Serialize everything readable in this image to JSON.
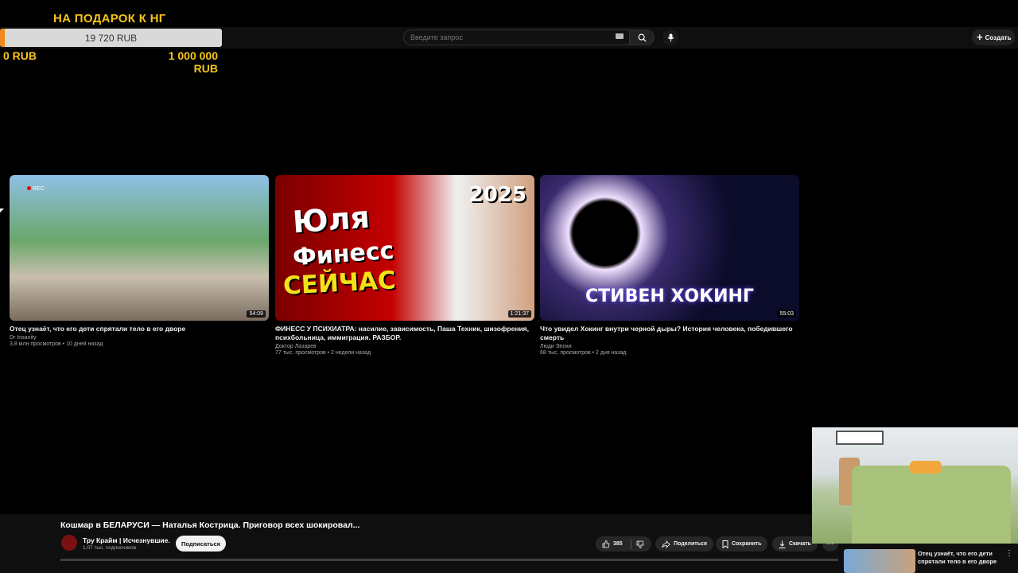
{
  "donation": {
    "title": "НА ПОДАРОК К НГ",
    "amount": "19 720 RUB",
    "min": "0 RUB",
    "max": "1 000 000 RUB",
    "progress_fraction": 0.0197,
    "fill_color": "#f08a1c",
    "text_color": "#f5c518"
  },
  "header": {
    "search_placeholder": "Введите запрос",
    "create_label": "Создать"
  },
  "videos": [
    {
      "title": "Отец узнаёт, что его дети спрятали тело в его дворе",
      "channel": "Dr Insanity",
      "meta": "3,8 млн просмотров • 10 дней назад",
      "duration": "54:09",
      "overlay": "REC"
    },
    {
      "title": "ФИНЕСС У ПСИХИАТРА: насилие, зависимость, Паша Техник, шизофрения, психбольница, иммиграция. РАЗБОР.",
      "channel": "Доктор Лазарев",
      "meta": "77 тыс. просмотров • 2 недели назад",
      "duration": "1:21:37",
      "overlay_lines": [
        "Юля",
        "Финесс",
        "СЕЙЧАС",
        "2025"
      ]
    },
    {
      "title": "Что увидел Хокинг внутри черной дыры? История человека, победившего смерть",
      "channel": "Люди Эпохи",
      "meta": "68 тыс. просмотров • 2 дня назад",
      "duration": "55:03",
      "overlay": "СТИВЕН ХОКИНГ"
    }
  ],
  "now_playing": {
    "title": "Кошмар в БЕЛАРУСИ — Наталья Кострица. Приговор всех шокировал...",
    "channel": "Тру Крайм | Исчезнувшие.",
    "subscribers": "1,07 тыс. подписчиков",
    "subscribe_label": "Подписаться",
    "likes": "385",
    "share_label": "Поделиться",
    "save_label": "Сохранить",
    "download_label": "Скачать",
    "more_label": "⋯"
  },
  "next_up": {
    "title": "Отец узнаёт, что его дети спрятали тело в его дворе"
  }
}
